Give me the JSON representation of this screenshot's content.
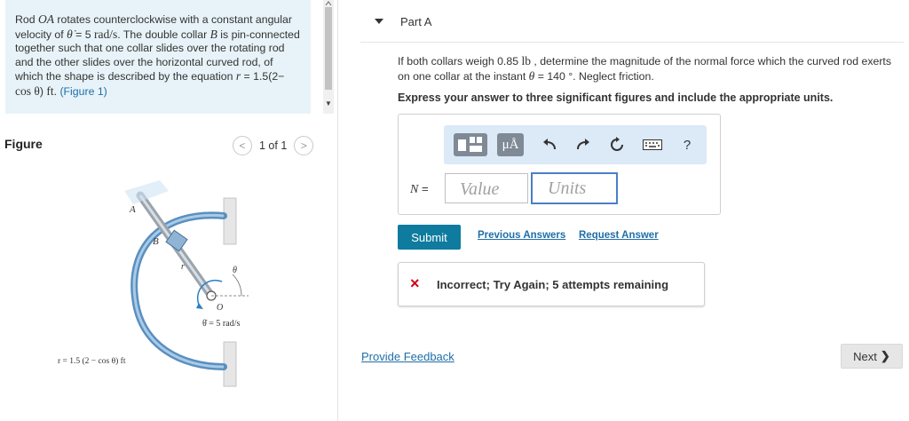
{
  "problem": {
    "text_1": "Rod ",
    "rod_name": "OA",
    "text_2": " rotates counterclockwise with a constant angular velocity of ",
    "theta_dot": "θ̇",
    "text_3": " = 5 ",
    "unit_rad_s": "rad/s",
    "text_4": ". The double collar ",
    "collar_name": "B",
    "text_5": " is pin-connected together such that one collar slides over the rotating rod and the other slides over the horizontal curved rod, of which the shape is described by the equation ",
    "r_sym": "r",
    "text_6": " = 1.5(2− ",
    "cos_theta": "cos θ",
    "text_7": ") ",
    "unit_ft": "ft",
    "text_8": ". ",
    "figure_link": "(Figure 1)"
  },
  "figure_panel": {
    "title": "Figure",
    "pager_text": "1 of 1",
    "prev_icon": "chevron-left",
    "next_icon": "chevron-right",
    "labels": {
      "A": "A",
      "B": "B",
      "r": "r",
      "theta": "θ",
      "O": "O",
      "omega": "θ̇ = 5 rad/s",
      "equation": "r = 1.5 (2 − cos θ) ft"
    }
  },
  "part": {
    "title": "Part A",
    "question_1": "If both collars weigh 0.85 ",
    "weight_unit": "lb",
    "question_2": " , determine the magnitude of the normal force which the curved rod exerts on one collar at the instant ",
    "theta_sym": "θ",
    "question_3": " = 140 °. Neglect friction.",
    "instruction": "Express your answer to three significant figures and include the appropriate units."
  },
  "toolbar": {
    "templates_icon": "templates-icon",
    "mu_label": "μÅ",
    "undo_icon": "undo-arrow",
    "redo_icon": "redo-arrow",
    "reset_icon": "reset-circle",
    "keyboard_icon": "keyboard",
    "help_label": "?"
  },
  "answer": {
    "variable": "N",
    "equals": " =",
    "value_placeholder": "Value",
    "units_placeholder": "Units"
  },
  "actions": {
    "submit_label": "Submit",
    "previous_answers": "Previous Answers",
    "request_answer": "Request Answer"
  },
  "feedback": {
    "icon": "×",
    "message": "Incorrect; Try Again; 5 attempts remaining"
  },
  "footer": {
    "provide_feedback": "Provide Feedback",
    "next_label": "Next",
    "next_icon": "❯"
  },
  "colors": {
    "problem_bg": "#e7f3f8",
    "toolbar_bg": "#dce9f6",
    "submit_bg": "#0f7b9e",
    "link": "#1f6ea8",
    "error": "#d0021b",
    "units_border": "#4b7fc8"
  }
}
